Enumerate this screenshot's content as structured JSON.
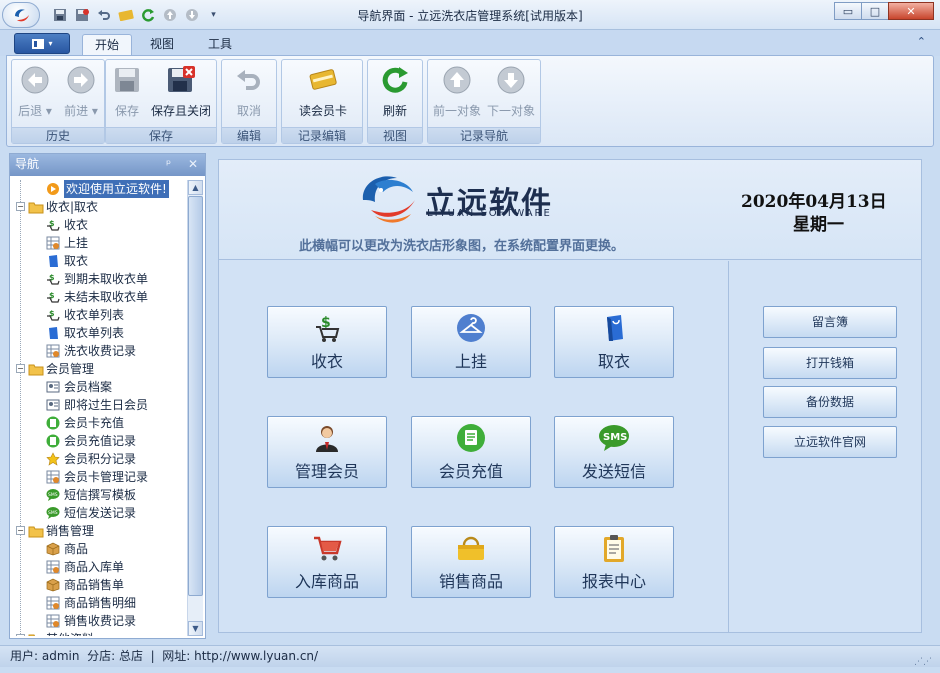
{
  "window": {
    "title": "导航界面 - 立远洗衣店管理系统[试用版本]"
  },
  "ribbon": {
    "tabs": [
      "开始",
      "视图",
      "工具"
    ],
    "groups": [
      {
        "label": "历史",
        "buttons": [
          {
            "label": "后退",
            "icon": "arrow-left-icon"
          },
          {
            "label": "前进",
            "icon": "arrow-right-icon"
          }
        ]
      },
      {
        "label": "保存",
        "buttons": [
          {
            "label": "保存",
            "icon": "save-icon"
          },
          {
            "label": "保存且关闭",
            "icon": "save-close-icon"
          }
        ]
      },
      {
        "label": "编辑",
        "buttons": [
          {
            "label": "取消",
            "icon": "undo-icon"
          }
        ]
      },
      {
        "label": "记录编辑",
        "buttons": [
          {
            "label": "读会员卡",
            "icon": "card-icon"
          }
        ]
      },
      {
        "label": "视图",
        "buttons": [
          {
            "label": "刷新",
            "icon": "refresh-icon"
          }
        ]
      },
      {
        "label": "记录导航",
        "buttons": [
          {
            "label": "前一对象",
            "icon": "arrow-up-icon"
          },
          {
            "label": "下一对象",
            "icon": "arrow-down-icon"
          }
        ]
      }
    ]
  },
  "nav": {
    "title": "导航",
    "pin_glyph": "ᵖ",
    "close_glyph": "✕",
    "items": [
      {
        "label": "欢迎使用立远软件!",
        "level": 1,
        "icon": "welcome-icon",
        "selected": true
      },
      {
        "label": "收衣|取衣",
        "level": 0,
        "icon": "folder-icon"
      },
      {
        "label": "收衣",
        "level": 1,
        "icon": "money-cart-icon"
      },
      {
        "label": "上挂",
        "level": 1,
        "icon": "grid-icon"
      },
      {
        "label": "取衣",
        "level": 1,
        "icon": "bag-icon"
      },
      {
        "label": "到期未取收衣单",
        "level": 1,
        "icon": "money-cart-icon"
      },
      {
        "label": "未结未取收衣单",
        "level": 1,
        "icon": "money-cart-icon"
      },
      {
        "label": "收衣单列表",
        "level": 1,
        "icon": "money-cart-icon"
      },
      {
        "label": "取衣单列表",
        "level": 1,
        "icon": "bag-icon"
      },
      {
        "label": "洗衣收费记录",
        "level": 1,
        "icon": "grid-icon"
      },
      {
        "label": "会员管理",
        "level": 0,
        "icon": "folder-icon"
      },
      {
        "label": "会员档案",
        "level": 1,
        "icon": "id-card-icon"
      },
      {
        "label": "即将过生日会员",
        "level": 1,
        "icon": "id-card-icon"
      },
      {
        "label": "会员卡充值",
        "level": 1,
        "icon": "green-doc-icon"
      },
      {
        "label": "会员充值记录",
        "level": 1,
        "icon": "green-doc-icon"
      },
      {
        "label": "会员积分记录",
        "level": 1,
        "icon": "star-icon"
      },
      {
        "label": "会员卡管理记录",
        "level": 1,
        "icon": "grid-icon"
      },
      {
        "label": "短信撰写模板",
        "level": 1,
        "icon": "sms-icon"
      },
      {
        "label": "短信发送记录",
        "level": 1,
        "icon": "sms-icon"
      },
      {
        "label": "销售管理",
        "level": 0,
        "icon": "folder-icon"
      },
      {
        "label": "商品",
        "level": 1,
        "icon": "box-icon"
      },
      {
        "label": "商品入库单",
        "level": 1,
        "icon": "grid-icon"
      },
      {
        "label": "商品销售单",
        "level": 1,
        "icon": "box-icon"
      },
      {
        "label": "商品销售明细",
        "level": 1,
        "icon": "grid-icon"
      },
      {
        "label": "销售收费记录",
        "level": 1,
        "icon": "grid-icon"
      },
      {
        "label": "其他资料",
        "level": 0,
        "icon": "folder-icon"
      }
    ]
  },
  "banner": {
    "logo_text": "立远软件",
    "logo_sub": "LIYUAN SOFTWARE",
    "note": "此横幅可以更改为洗衣店形象图，在系统配置界面更换。",
    "date": "2020年04月13日",
    "weekday": "星期一"
  },
  "tiles": [
    {
      "label": "收衣",
      "icon": "money-cart-icon"
    },
    {
      "label": "上挂",
      "icon": "hanger-icon"
    },
    {
      "label": "取衣",
      "icon": "bag-icon"
    },
    {
      "label": "管理会员",
      "icon": "person-icon"
    },
    {
      "label": "会员充值",
      "icon": "green-doc-icon"
    },
    {
      "label": "发送短信",
      "icon": "sms-icon"
    },
    {
      "label": "入库商品",
      "icon": "cart-icon"
    },
    {
      "label": "销售商品",
      "icon": "basket-icon"
    },
    {
      "label": "报表中心",
      "icon": "clipboard-icon"
    }
  ],
  "side_buttons": [
    "留言簿",
    "打开钱箱",
    "备份数据",
    "立远软件官网"
  ],
  "status": {
    "text": "用户: admin  分店: 总店  |  网址: http://www.lyuan.cn/"
  },
  "colors": {
    "accent": "#3f6fb7",
    "ribbon_bg": "#c6d9f1",
    "tile_border": "#7ea2cf",
    "close_red": "#c8452c"
  }
}
